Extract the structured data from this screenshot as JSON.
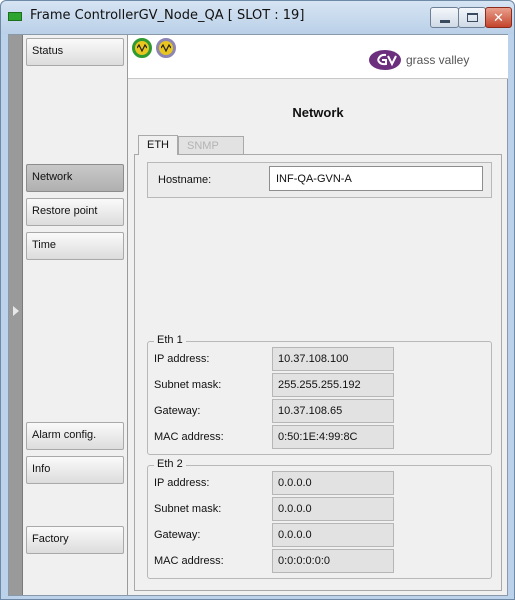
{
  "window": {
    "title": "Frame ControllerGV_Node_QA [ SLOT : 19]",
    "controls": {
      "minimize": "minimize-icon",
      "maximize": "maximize-icon",
      "close": "✕"
    }
  },
  "sidebar": {
    "items": [
      {
        "label": "Status",
        "active": false
      },
      {
        "label": "Network",
        "active": true
      },
      {
        "label": "Restore point",
        "active": false
      },
      {
        "label": "Time",
        "active": false
      },
      {
        "label": "Alarm config.",
        "active": false
      },
      {
        "label": "Info",
        "active": false
      },
      {
        "label": "Factory",
        "active": false
      }
    ]
  },
  "header": {
    "logo_text": "grass valley"
  },
  "main": {
    "title": "Network",
    "tabs": [
      {
        "label": "ETH",
        "active": true
      },
      {
        "label": "SNMP",
        "active": false
      }
    ],
    "hostname": {
      "label": "Hostname:",
      "value": "INF-QA-GVN-A"
    },
    "eth1": {
      "title": "Eth 1",
      "rows": [
        {
          "label": "IP address:",
          "value": "10.37.108.100"
        },
        {
          "label": "Subnet mask:",
          "value": "255.255.255.192"
        },
        {
          "label": "Gateway:",
          "value": "10.37.108.65"
        },
        {
          "label": "MAC address:",
          "value": "0:50:1E:4:99:8C"
        }
      ]
    },
    "eth2": {
      "title": "Eth 2",
      "rows": [
        {
          "label": "IP address:",
          "value": "0.0.0.0"
        },
        {
          "label": "Subnet mask:",
          "value": "0.0.0.0"
        },
        {
          "label": "Gateway:",
          "value": "0.0.0.0"
        },
        {
          "label": "MAC address:",
          "value": "0:0:0:0:0:0"
        }
      ]
    }
  },
  "colors": {
    "titlebar": "#bcd2ea",
    "brand_purple": "#6b2f7e",
    "status_green": "#2f9a2f",
    "status_yellow": "#e8c51f"
  }
}
